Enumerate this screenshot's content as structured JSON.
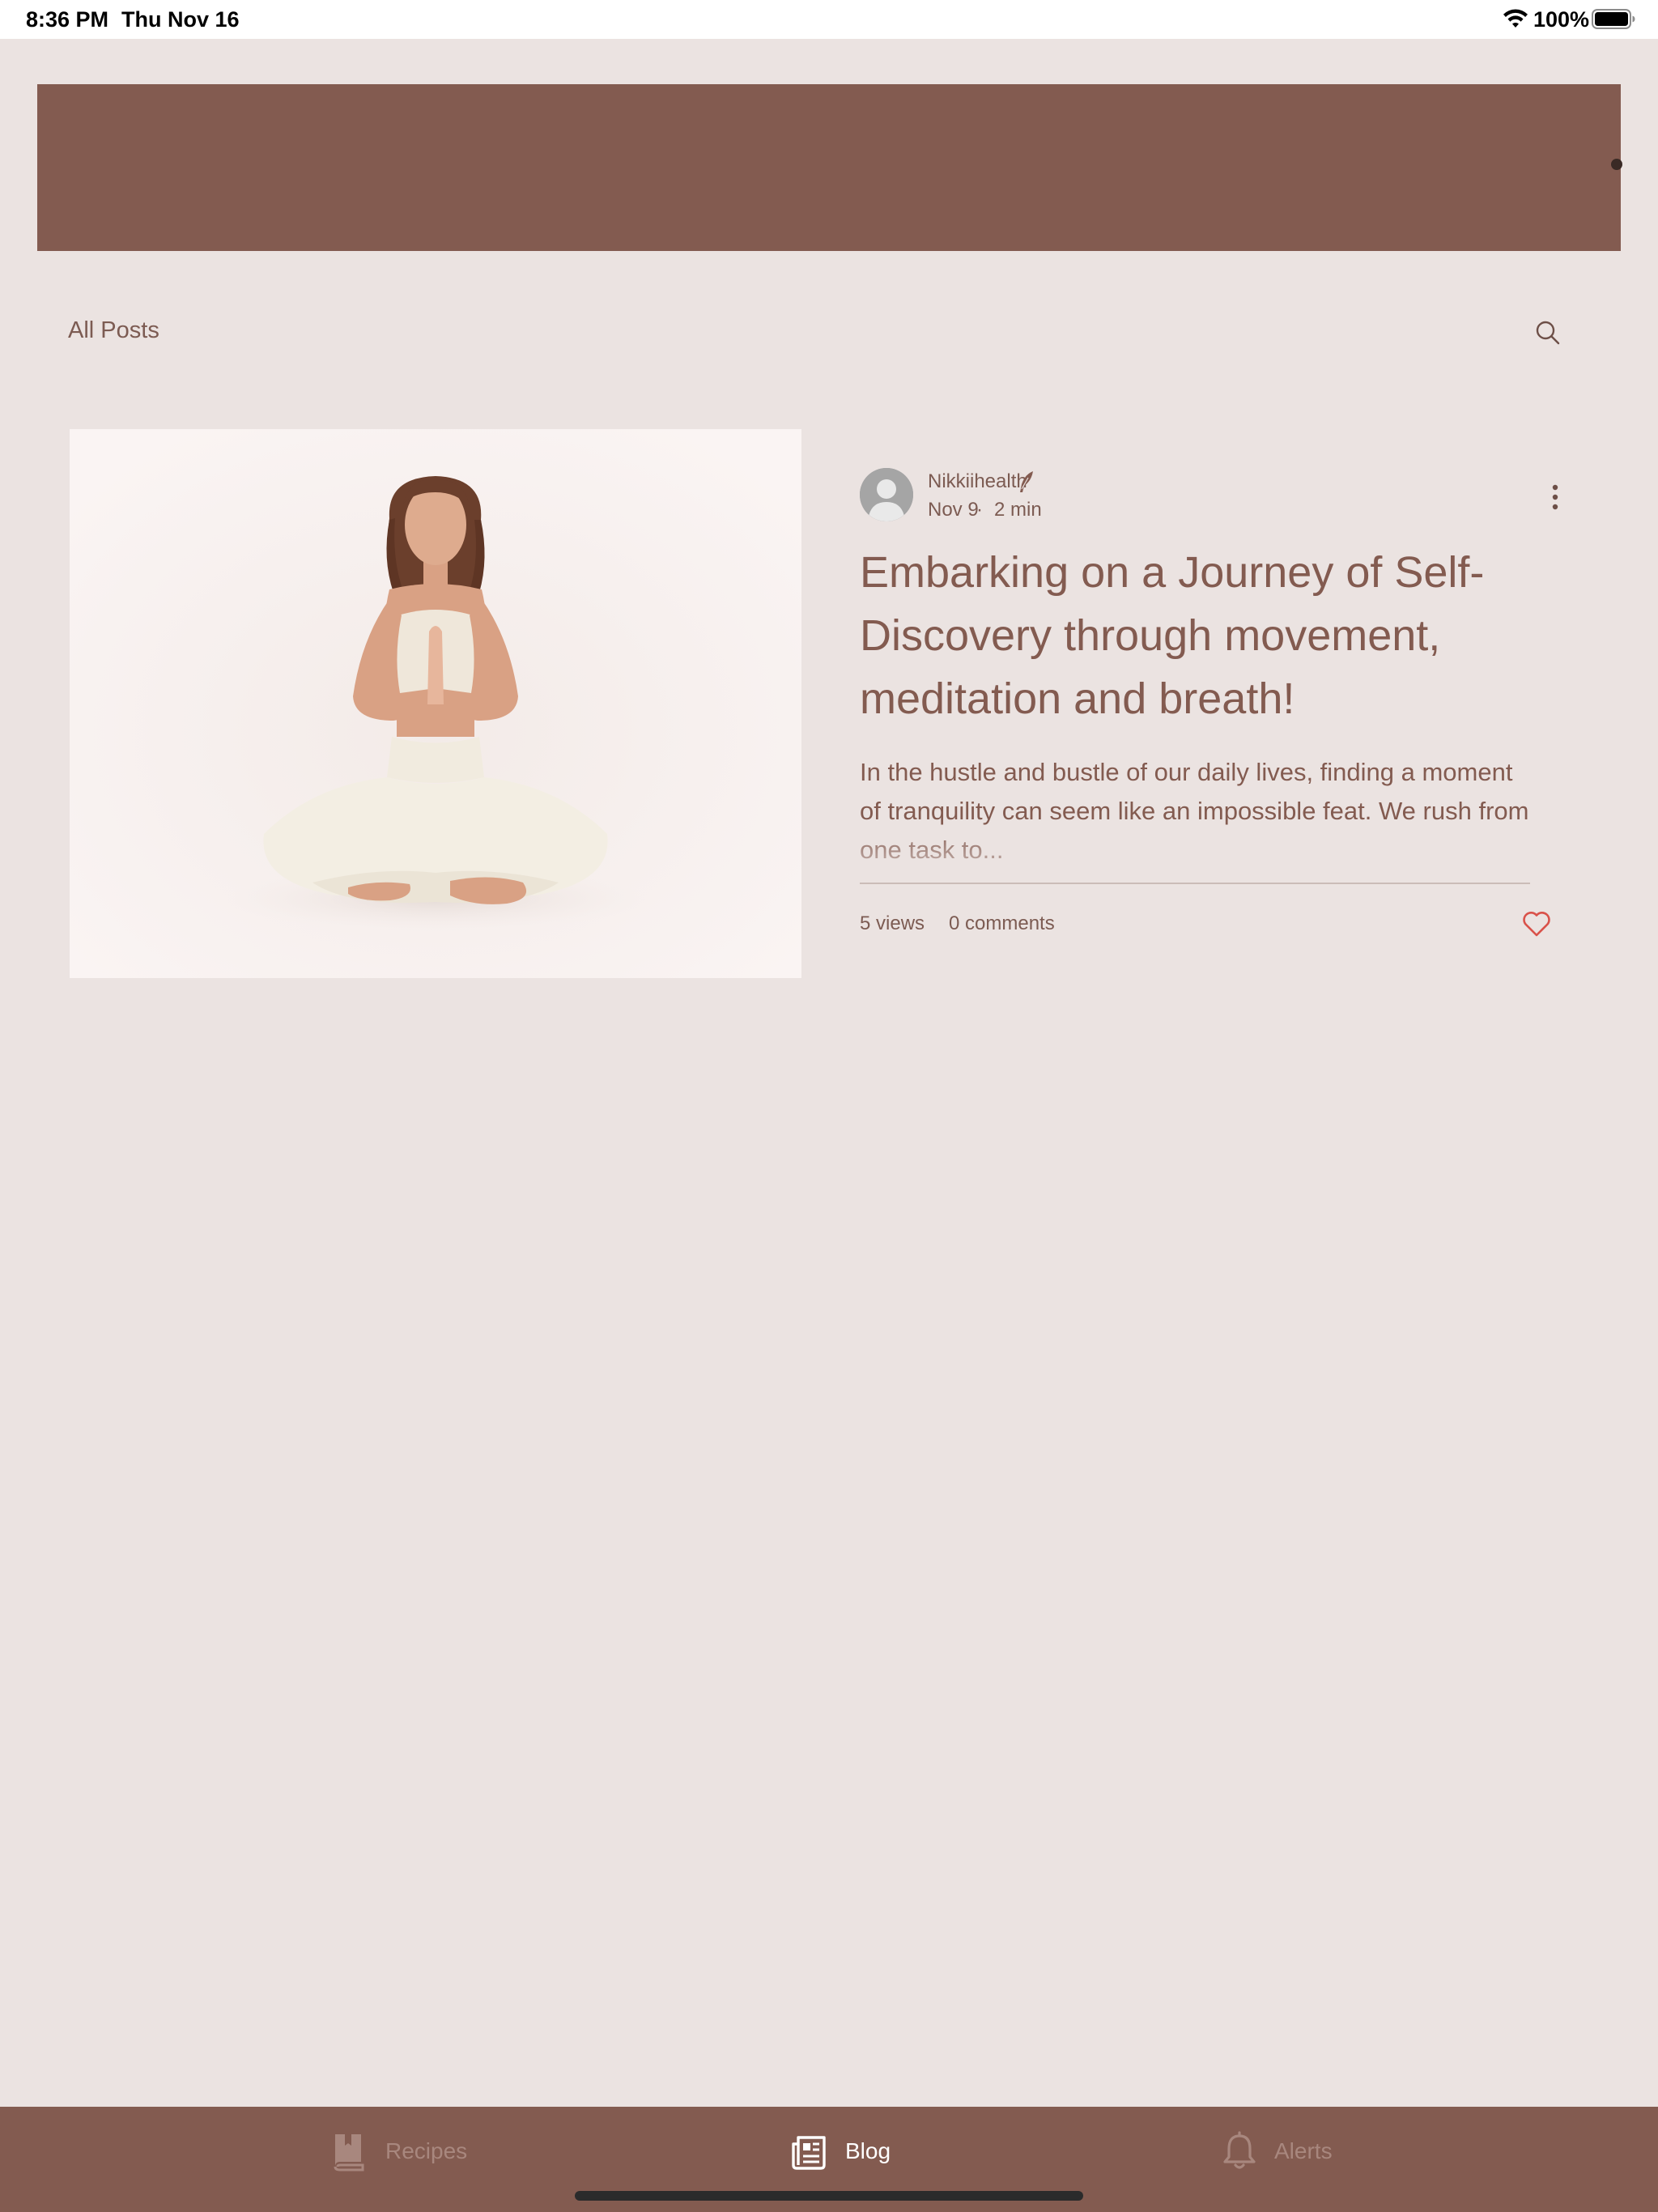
{
  "status_bar": {
    "time": "8:36 PM",
    "date": "Thu Nov 16",
    "battery_level": "100%",
    "battery_fraction": 1.0
  },
  "blog_nav": {
    "all_posts_label": "All Posts",
    "search_icon": "search-icon"
  },
  "post": {
    "author": "Nikkiihealth",
    "author_badge_icon": "quill-icon",
    "date": "Nov 9",
    "separator": "·",
    "read_time": "2 min",
    "title": "Embarking on a Journey of Self-Discovery through movement, meditation and breath!",
    "excerpt": "In the hustle and bustle of our daily lives, finding a moment of tranquility can seem like an impossible feat. We rush from one task to...",
    "views": "5 views",
    "comments": "0 comments",
    "image_subject": "woman-meditating-photo",
    "more_icon": "more-vertical-icon",
    "like_icon": "heart-icon"
  },
  "tabs": [
    {
      "label": "Recipes",
      "icon": "book-icon",
      "active": false
    },
    {
      "label": "Blog",
      "icon": "newspaper-icon",
      "active": true
    },
    {
      "label": "Alerts",
      "icon": "bell-icon",
      "active": false
    }
  ],
  "colors": {
    "background": "#ebe3e1",
    "brand": "#835b50",
    "text": "#7c5b52",
    "like": "#d9524a",
    "tab_inactive": "#a8877e",
    "tab_active": "#ffffff"
  }
}
